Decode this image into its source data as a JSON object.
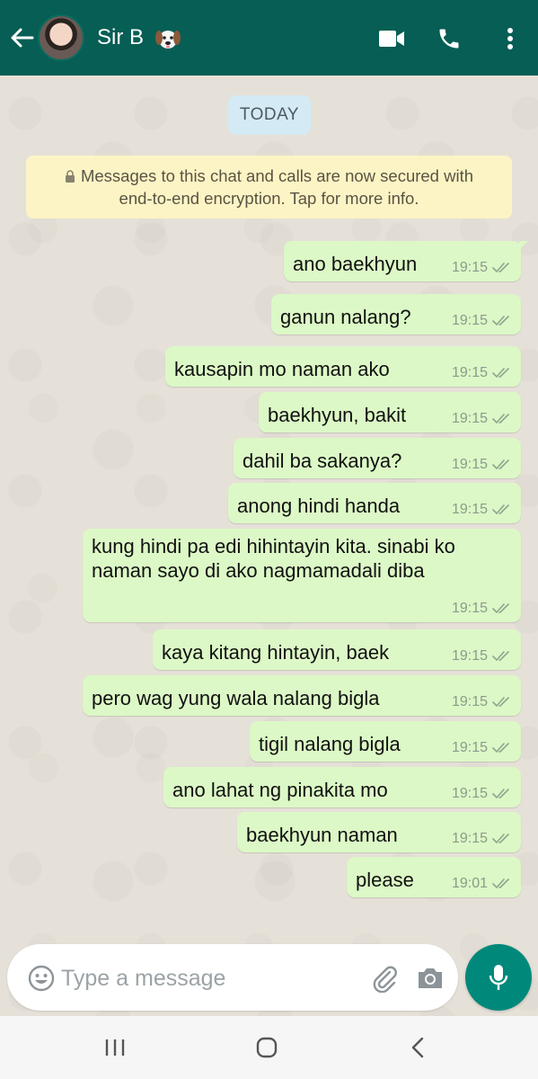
{
  "header": {
    "contact_name": "Sir B",
    "contact_emoji": "dog-face-emoji"
  },
  "chat": {
    "date_chip": "TODAY",
    "encryption_notice_line1": "Messages to this chat and calls are now secured with",
    "encryption_notice_line2": "end-to-end encryption. Tap for more info.",
    "messages": [
      {
        "text": "ano baekhyun",
        "time": "19:15",
        "status": "read"
      },
      {
        "text": "ganun nalang?",
        "time": "19:15",
        "status": "read"
      },
      {
        "text": "kausapin mo naman ako",
        "time": "19:15",
        "status": "read"
      },
      {
        "text": "baekhyun, bakit",
        "time": "19:15",
        "status": "read"
      },
      {
        "text": "dahil ba sakanya?",
        "time": "19:15",
        "status": "read"
      },
      {
        "text": "anong hindi handa",
        "time": "19:15",
        "status": "read"
      },
      {
        "text": "kung hindi pa edi hihintayin kita. sinabi ko naman sayo di ako nagmamadali diba",
        "time": "19:15",
        "status": "read"
      },
      {
        "text": "kaya kitang hintayin, baek",
        "time": "19:15",
        "status": "read"
      },
      {
        "text": "pero wag yung wala nalang bigla",
        "time": "19:15",
        "status": "read"
      },
      {
        "text": "tigil nalang bigla",
        "time": "19:15",
        "status": "read"
      },
      {
        "text": "ano lahat ng pinakita mo",
        "time": "19:15",
        "status": "read"
      },
      {
        "text": "baekhyun naman",
        "time": "19:15",
        "status": "read"
      },
      {
        "text": "please",
        "time": "19:01",
        "status": "read"
      }
    ]
  },
  "composer": {
    "placeholder": "Type a message"
  },
  "colors": {
    "header": "#075e54",
    "outgoing_bubble": "#dcf8c6",
    "mic_button": "#00897b",
    "encryption_bg": "#fdf4c5",
    "date_chip_bg": "#d4eaf4"
  }
}
